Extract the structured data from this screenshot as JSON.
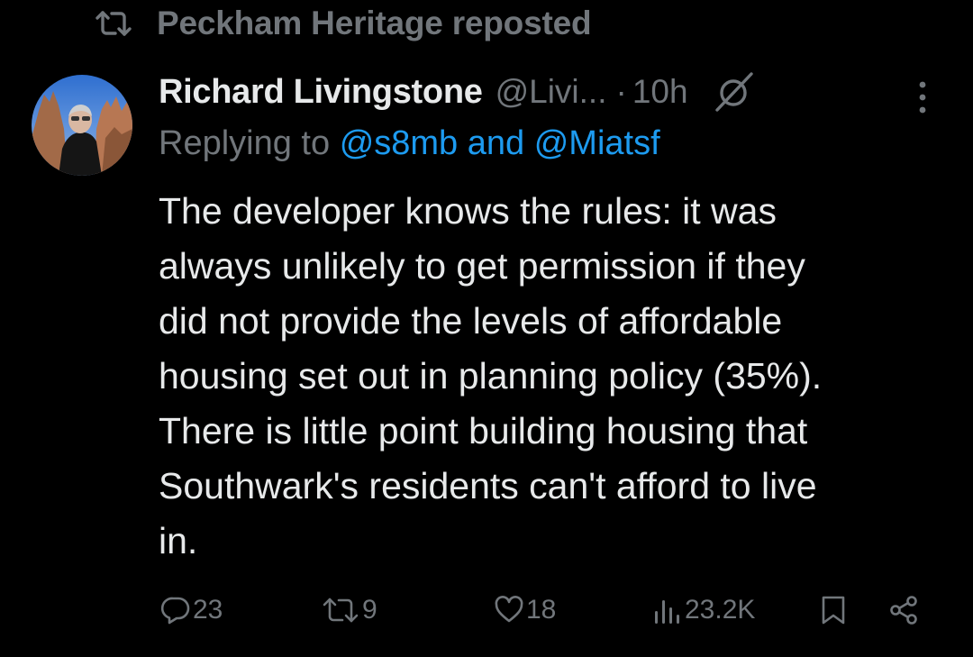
{
  "repost": {
    "label": "Peckham Heritage reposted"
  },
  "tweet": {
    "author_name": "Richard Livingstone",
    "author_handle": "@Livi...",
    "separator": "·",
    "time": "10h",
    "replying_prefix": "Replying to",
    "reply_user_1": "@s8mb",
    "reply_and": "and",
    "reply_user_2": "@Miatsf",
    "lines": [
      "The developer knows the rules: it was",
      "always unlikely to get permission if they",
      "did not provide the levels of affordable",
      "housing set out in planning policy (35%).",
      "There is little point building housing that",
      "Southwark's residents can't afford to live",
      "in."
    ]
  },
  "actions": {
    "replies": "23",
    "reposts": "9",
    "likes": "18",
    "views": "23.2K"
  },
  "colors": {
    "background": "#000000",
    "text": "#e7e9ea",
    "muted": "#71767b",
    "link": "#1d9bf0"
  },
  "icons": {
    "repost": "repost-icon",
    "grok": "grok-icon",
    "more": "more-icon",
    "reply": "reply-icon",
    "like": "heart-icon",
    "views": "views-icon",
    "bookmark": "bookmark-icon",
    "share": "share-icon"
  }
}
